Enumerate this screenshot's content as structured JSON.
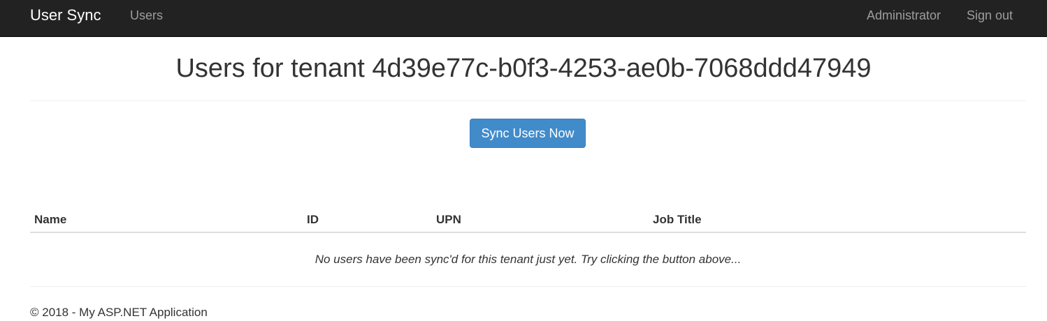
{
  "navbar": {
    "brand": "User Sync",
    "links": [
      "Users"
    ],
    "right_links": [
      "Administrator",
      "Sign out"
    ]
  },
  "main": {
    "title": "Users for tenant 4d39e77c-b0f3-4253-ae0b-7068ddd47949",
    "sync_button_label": "Sync Users Now",
    "table": {
      "columns": [
        "Name",
        "ID",
        "UPN",
        "Job Title"
      ],
      "rows": [],
      "empty_message": "No users have been sync'd for this tenant just yet. Try clicking the button above..."
    }
  },
  "footer": {
    "text": "© 2018 - My ASP.NET Application"
  },
  "colors": {
    "navbar_bg": "#222222",
    "nav_link": "#9d9d9d",
    "primary_button": "#428bca"
  }
}
